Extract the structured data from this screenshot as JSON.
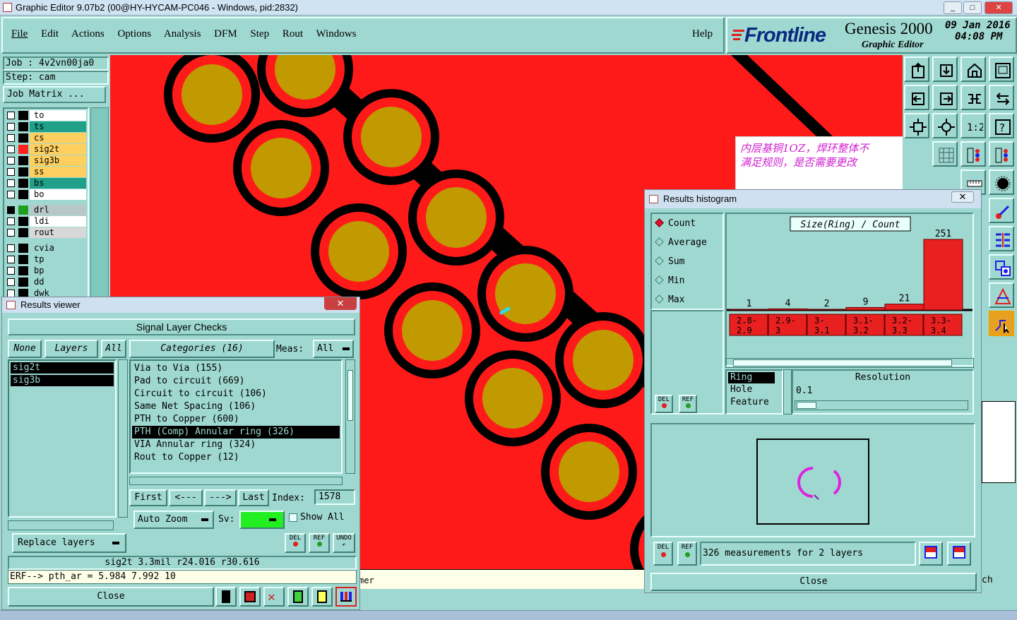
{
  "window": {
    "title": "Graphic Editor 9.07b2 (00@HY-HYCAM-PC046 - Windows, pid:2832)",
    "controls": [
      "_",
      "□",
      "✕"
    ]
  },
  "menu": {
    "items": [
      "File",
      "Edit",
      "Actions",
      "Options",
      "Analysis",
      "DFM",
      "Step",
      "Rout",
      "Windows"
    ],
    "help": "Help"
  },
  "brand": {
    "logo": "Frontline",
    "product": "Genesis 2000",
    "subtitle": "Graphic Editor",
    "date": "09 Jan 2016",
    "time": "04:08 PM"
  },
  "job": {
    "job_label": "Job : 4v2vn00ja0",
    "step_label": "Step: cam",
    "matrix_button": "Job Matrix ..."
  },
  "layers": [
    {
      "name": "to",
      "color": "#ffffff"
    },
    {
      "name": "ts",
      "color": "#20a088"
    },
    {
      "name": "cs",
      "color": "#ffd060"
    },
    {
      "name": "sig2t",
      "color": "#ffd060",
      "swatch": "#ff2020"
    },
    {
      "name": "sig3b",
      "color": "#ffd060"
    },
    {
      "name": "ss",
      "color": "#ffd060"
    },
    {
      "name": "bs",
      "color": "#20a088"
    },
    {
      "name": "bo",
      "color": "#ffffff"
    },
    {
      "name": "drl",
      "color": "#b8c8c8",
      "swatch": "#20a020"
    },
    {
      "name": "ldi",
      "color": "#ffffff"
    },
    {
      "name": "rout",
      "color": "#d8d8d8"
    },
    {
      "name": "cvia",
      "color": "#9fd8d0"
    },
    {
      "name": "tp",
      "color": "#9fd8d0"
    },
    {
      "name": "bp",
      "color": "#9fd8d0"
    },
    {
      "name": "dd",
      "color": "#9fd8d0"
    },
    {
      "name": "dwk",
      "color": "#9fd8d0"
    }
  ],
  "annotation": {
    "line1": "内层基铜1OZ，焊环整体不",
    "line2": "满足规则，是否需要更改"
  },
  "results_viewer": {
    "title": "Results viewer",
    "heading": "Signal Layer Checks",
    "none_btn": "None",
    "layers_btn": "Layers",
    "all_btn": "All",
    "categories_label": "Categories (16)",
    "meas_label": "Meas:",
    "meas_value": "All",
    "layer_list": [
      "sig2t",
      "sig3b"
    ],
    "categories": [
      "Via to Via (155)",
      "Pad to circuit (669)",
      "Circuit to circuit (106)",
      "Same Net Spacing (106)",
      "PTH to Copper (600)",
      "PTH (Comp) Annular ring (326)",
      "VIA Annular ring (324)",
      "Rout to Copper (12)"
    ],
    "selected_category_index": 5,
    "first_btn": "First",
    "prev_btn": "<---",
    "next_btn": "--->",
    "last_btn": "Last",
    "index_label": "Index:",
    "index_value": "1578",
    "auto_zoom": "Auto Zoom",
    "sv_label": "Sv:",
    "show_all": "Show All",
    "replace_layers": "Replace layers",
    "del": "DEL",
    "ref": "REF",
    "undo": "UNDO",
    "status_line": "sig2t 3.3mil  r24.016  r30.616",
    "erf_line": "ERF--> pth_ar = 5.984 7.992 10",
    "close": "Close"
  },
  "histogram": {
    "title": "Results histogram",
    "modes": [
      "Count",
      "Average",
      "Sum",
      "Min",
      "Max"
    ],
    "selected_mode": "Count",
    "chart_title": "Size(Ring) / Count",
    "attrs": [
      "Ring",
      "Hole",
      "Feature"
    ],
    "selected_attr": "Ring",
    "resolution_label": "Resolution",
    "resolution_value": "0.1",
    "del": "DEL",
    "ref": "REF",
    "measurements": "326 measurements for 2 layers",
    "close": "Close"
  },
  "chart_data": {
    "type": "bar",
    "title": "Size(Ring) / Count",
    "categories": [
      "2.8-2.9",
      "2.9-3",
      "3-3.1",
      "3.1-3.2",
      "3.2-3.3",
      "3.3-3.4"
    ],
    "category_labels_top": [
      "2.8-",
      "2.9-",
      "3-",
      "3.1-",
      "3.2-",
      "3.3-"
    ],
    "category_labels_bottom": [
      "2.9",
      "3",
      "3.1",
      "3.2",
      "3.3",
      "3.4"
    ],
    "values": [
      1,
      4,
      2,
      9,
      21,
      251
    ],
    "ylim": [
      0,
      251
    ],
    "bar_color": "#e82020"
  },
  "bottom_partial": {
    "left_text": "mer",
    "right_text": "ch"
  }
}
